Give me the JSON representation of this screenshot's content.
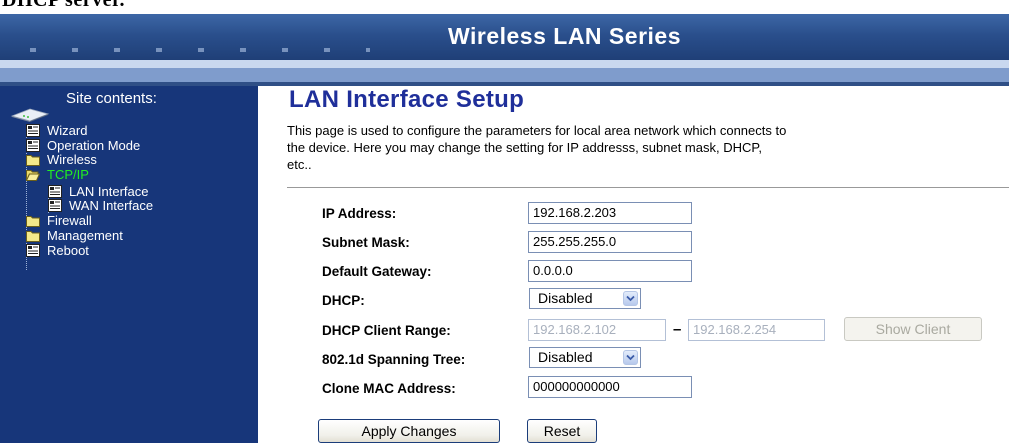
{
  "top_caption": "DHCP server.",
  "banner": {
    "title": "Wireless LAN Series"
  },
  "sidebar": {
    "heading": "Site contents:",
    "items": [
      {
        "label": "Wizard",
        "icon": "page-icon"
      },
      {
        "label": "Operation Mode",
        "icon": "page-icon"
      },
      {
        "label": "Wireless",
        "icon": "folder-icon"
      },
      {
        "label": "TCP/IP",
        "icon": "folder-open-icon",
        "active": true
      },
      {
        "label": "LAN Interface",
        "icon": "page-icon"
      },
      {
        "label": "WAN Interface",
        "icon": "page-icon"
      },
      {
        "label": "Firewall",
        "icon": "folder-icon"
      },
      {
        "label": "Management",
        "icon": "folder-icon"
      },
      {
        "label": "Reboot",
        "icon": "page-icon"
      }
    ]
  },
  "main": {
    "title": "LAN Interface Setup",
    "description_lines": [
      "This page is used to configure the parameters for local area network which connects to",
      "the device. Here you may change the setting for IP addresss, subnet mask, DHCP,",
      "etc.."
    ]
  },
  "form": {
    "ip_address_label": "IP Address:",
    "ip_address_value": "192.168.2.203",
    "subnet_mask_label": "Subnet Mask:",
    "subnet_mask_value": "255.255.255.0",
    "default_gateway_label": "Default Gateway:",
    "default_gateway_value": "0.0.0.0",
    "dhcp_label": "DHCP:",
    "dhcp_value": "Disabled",
    "dhcp_range_label": "DHCP Client Range:",
    "dhcp_range_start": "192.168.2.102",
    "dhcp_range_separator": "–",
    "dhcp_range_end": "192.168.2.254",
    "show_client_label": "Show Client",
    "stp_label": "802.1d Spanning Tree:",
    "stp_value": "Disabled",
    "clone_mac_label": "Clone MAC Address:",
    "clone_mac_value": "000000000000"
  },
  "buttons": {
    "apply_label": "Apply Changes",
    "reset_label": "Reset"
  },
  "colors": {
    "banner": "#2a4f8c",
    "sidebar": "#17367a",
    "title": "#1f2f9a",
    "active_item": "#22ee22"
  }
}
